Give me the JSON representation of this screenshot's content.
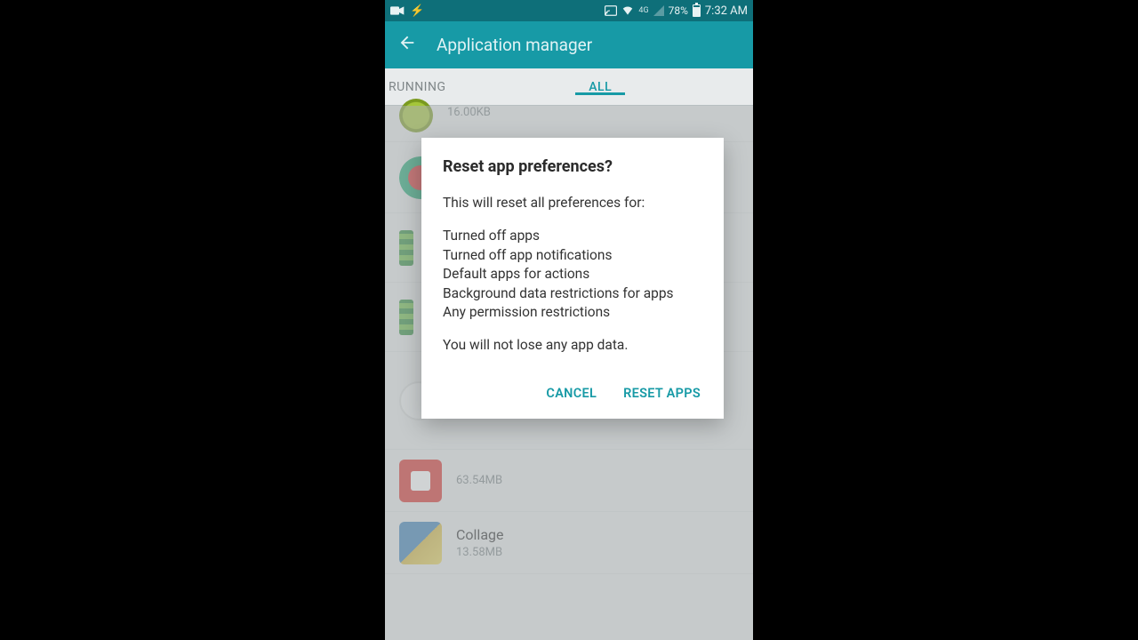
{
  "statusBar": {
    "batteryPct": "78%",
    "time": "7:32 AM"
  },
  "appBar": {
    "title": "Application manager"
  },
  "tabs": {
    "left": "RUNNING",
    "center": "ALL"
  },
  "apps": {
    "first_size": "16.00KB",
    "cinema_size": "63.54MB",
    "collage_name": "Collage",
    "collage_size": "13.58MB"
  },
  "dialog": {
    "title": "Reset app preferences?",
    "intro": "This will reset all preferences for:",
    "l1": "Turned off apps",
    "l2": "Turned off app notifications",
    "l3": "Default apps for actions",
    "l4": "Background data restrictions for apps",
    "l5": "Any permission restrictions",
    "outro": "You will not lose any app data.",
    "cancel": "CANCEL",
    "confirm": "RESET APPS"
  }
}
